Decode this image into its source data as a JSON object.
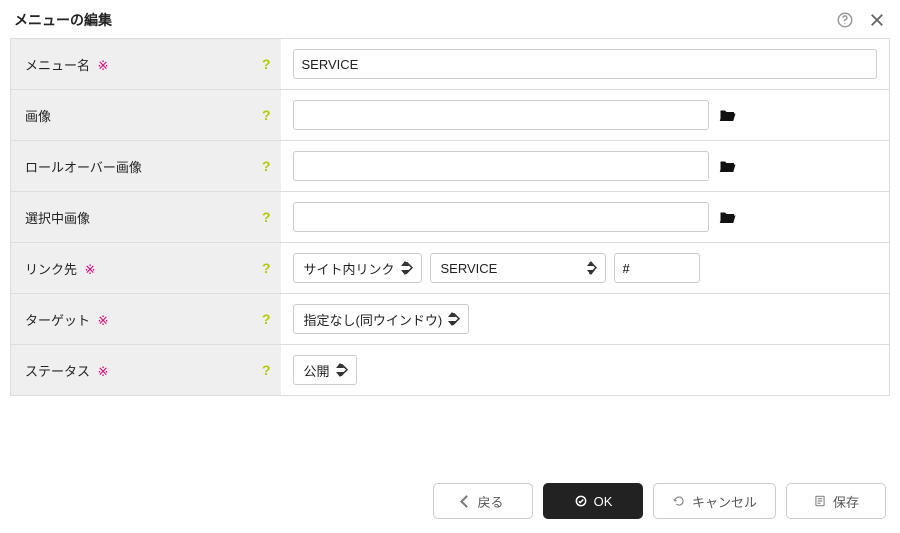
{
  "dialog": {
    "title": "メニューの編集"
  },
  "labels": {
    "menu_name": "メニュー名",
    "image": "画像",
    "rollover_image": "ロールオーバー画像",
    "selected_image": "選択中画像",
    "link": "リンク先",
    "target": "ターゲット",
    "status": "ステータス",
    "required_mark": "※"
  },
  "values": {
    "menu_name": "SERVICE",
    "image": "",
    "rollover_image": "",
    "selected_image": "",
    "link_type": "サイト内リンク",
    "link_page": "SERVICE",
    "link_anchor": "#",
    "target": "指定なし(同ウインドウ)",
    "status": "公開"
  },
  "buttons": {
    "back": "戻る",
    "ok": "OK",
    "cancel": "キャンセル",
    "save": "保存"
  }
}
